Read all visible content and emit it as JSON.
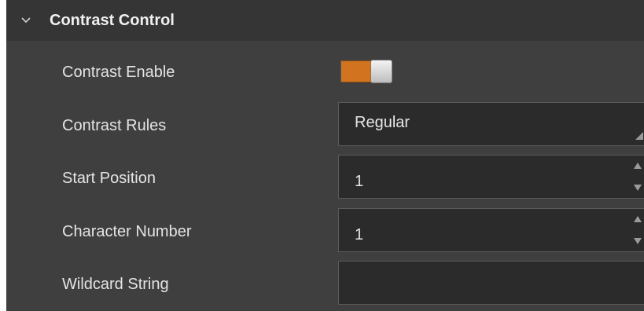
{
  "section": {
    "title": "Contrast Control",
    "expanded": true
  },
  "rows": {
    "contrast_enable": {
      "label": "Contrast Enable",
      "enabled": true
    },
    "contrast_rules": {
      "label": "Contrast Rules",
      "value": "Regular"
    },
    "start_position": {
      "label": "Start Position",
      "value": "1"
    },
    "character_number": {
      "label": "Character Number",
      "value": "1"
    },
    "wildcard_string": {
      "label": "Wildcard String",
      "value": ""
    }
  },
  "icons": {
    "collapse": "chevron-down-icon",
    "dropdown": "dropdown-corner-icon",
    "spin_up": "spin-up-icon",
    "spin_down": "spin-down-icon"
  },
  "colors": {
    "panel_bg": "#3f3f3f",
    "header_bg": "#353535",
    "field_bg": "#2b2b2b",
    "toggle_on": "#d2731f",
    "text": "#e4e4e4"
  }
}
